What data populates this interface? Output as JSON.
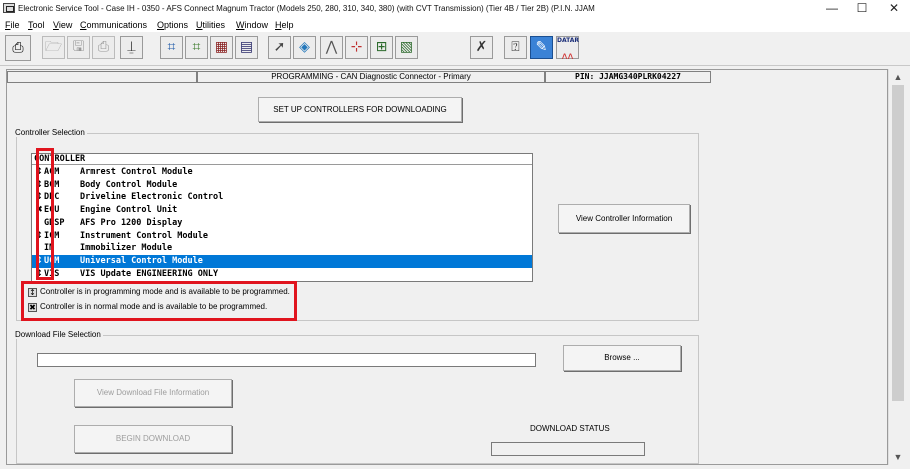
{
  "window": {
    "title": "Electronic Service Tool - Case IH - 0350 - AFS Connect Magnum Tractor (Models 250, 280, 310, 340, 380) (with CVT Transmission) (Tier 4B / Tier 2B) (P.I.N. JJAM",
    "minimize": "—",
    "maximize": "☐",
    "close": "✕"
  },
  "menu": [
    "File",
    "Tool",
    "View",
    "Communications",
    "Options",
    "Utilities",
    "Window",
    "Help"
  ],
  "toolbar": {
    "datar_label": "DATAR"
  },
  "status": {
    "mode": "PROGRAMMING  -  CAN Diagnostic Connector - Primary",
    "pin": "PIN: JJAMG340PLRK04227"
  },
  "buttons": {
    "setup": "SET UP CONTROLLERS FOR DOWNLOADING",
    "view_controller": "View Controller Information",
    "browse": "Browse ...",
    "view_download": "View Download File Information",
    "begin_download": "BEGIN DOWNLOAD"
  },
  "controller_selection": {
    "label": "Controller Selection",
    "header": "CONTROLLER",
    "rows": [
      {
        "icon": "↕",
        "code": "ACM",
        "name": "Armrest Control Module"
      },
      {
        "icon": "↕",
        "code": "BCM",
        "name": "Body Control Module"
      },
      {
        "icon": "↕",
        "code": "DEC",
        "name": "Driveline Electronic Control"
      },
      {
        "icon": "✖",
        "code": "ECU",
        "name": "Engine Control Unit"
      },
      {
        "icon": "",
        "code": "GDSP",
        "name": "AFS Pro 1200 Display"
      },
      {
        "icon": "↕",
        "code": "ICM",
        "name": "Instrument Control Module"
      },
      {
        "icon": "",
        "code": "IM",
        "name": "Immobilizer Module"
      },
      {
        "icon": "↕",
        "code": "UCM",
        "name": "Universal Control Module"
      },
      {
        "icon": "↕",
        "code": "VIS",
        "name": "VIS Update ENGINEERING ONLY"
      }
    ]
  },
  "legend": {
    "programming": {
      "icon": "↕",
      "text": "Controller is in programming mode and is available to be programmed."
    },
    "normal": {
      "icon": "✖",
      "text": "Controller is in normal mode and is available to be programmed."
    }
  },
  "download": {
    "label": "Download File Selection",
    "file_value": "",
    "status_label": "DOWNLOAD STATUS",
    "status_value": ""
  },
  "colors": {
    "selection": "#0078d7",
    "highlight_box": "#e0141e"
  }
}
